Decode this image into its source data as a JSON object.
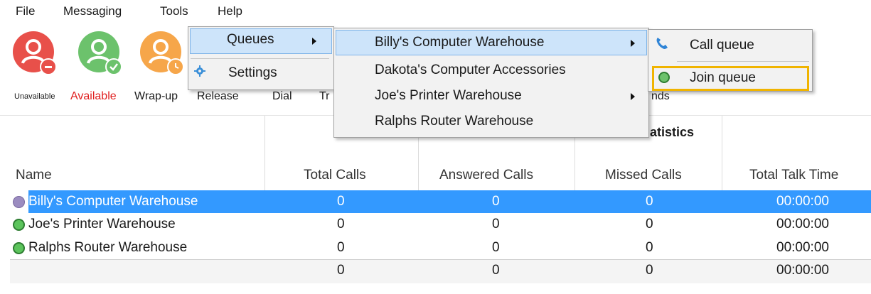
{
  "menubar": {
    "file": "File",
    "messaging": "Messaging",
    "tools": "Tools",
    "help": "Help"
  },
  "toolbar": {
    "unavailable": "Unavailable",
    "available": "Available",
    "wrapup": "Wrap-up",
    "release": "Release",
    "dial": "Dial",
    "transfer": "Tr",
    "commands": "nds"
  },
  "menus": {
    "tools": {
      "queues": "Queues",
      "settings": "Settings"
    },
    "queues": [
      "Billy's Computer Warehouse",
      "Dakota's Computer Accessories",
      "Joe's Printer Warehouse",
      "Ralphs Router Warehouse"
    ],
    "queue_actions": {
      "call_queue": "Call queue",
      "join_queue": "Join queue"
    }
  },
  "table": {
    "group_header": "atistics",
    "columns": [
      "Name",
      "Total Calls",
      "Answered Calls",
      "Missed Calls",
      "Total Talk Time"
    ],
    "rows": [
      {
        "name": "Billy's Computer Warehouse",
        "total": "0",
        "answered": "0",
        "missed": "0",
        "talk": "00:00:00",
        "status_color": "#9b8cc0"
      },
      {
        "name": "Joe's Printer Warehouse",
        "total": "0",
        "answered": "0",
        "missed": "0",
        "talk": "00:00:00",
        "status_color": "#5cc45c"
      },
      {
        "name": "Ralphs Router Warehouse",
        "total": "0",
        "answered": "0",
        "missed": "0",
        "talk": "00:00:00",
        "status_color": "#5cc45c"
      }
    ],
    "totals": {
      "total": "0",
      "answered": "0",
      "missed": "0",
      "talk": "00:00:00"
    }
  },
  "colors": {
    "unavailable": "#e8504a",
    "available": "#6cc26c",
    "wrapup": "#f6a64a",
    "selection": "#3399ff",
    "highlight_box": "#f0b400",
    "available_text": "#e02020"
  }
}
